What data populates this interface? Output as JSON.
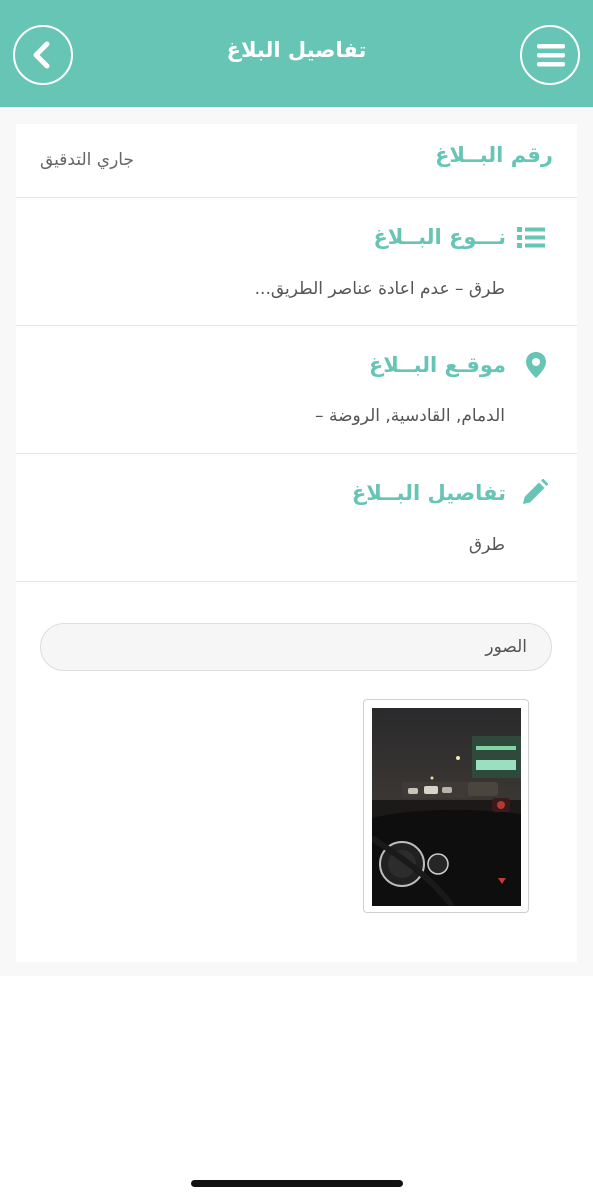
{
  "header": {
    "title": "تفاصيل البلاغ",
    "back_icon": "chevron-left-icon",
    "menu_icon": "hamburger-menu-icon",
    "color": "#66c5b4"
  },
  "report_number": {
    "label": "رقم البــلاغ",
    "status": "جاري التدقيق"
  },
  "report_type": {
    "label": "نـــوع البــلاغ",
    "icon": "list-icon",
    "value": "طرق – عدم اعادة عناصر الطريق..."
  },
  "report_location": {
    "label": "موقـع البــلاغ",
    "icon": "map-pin-icon",
    "value": "الدمام, القادسية, الروضة –"
  },
  "report_details": {
    "label": "تفاصيل البــلاغ",
    "icon": "pencil-icon",
    "value": "طرق"
  },
  "photos": {
    "label": "الصور"
  }
}
